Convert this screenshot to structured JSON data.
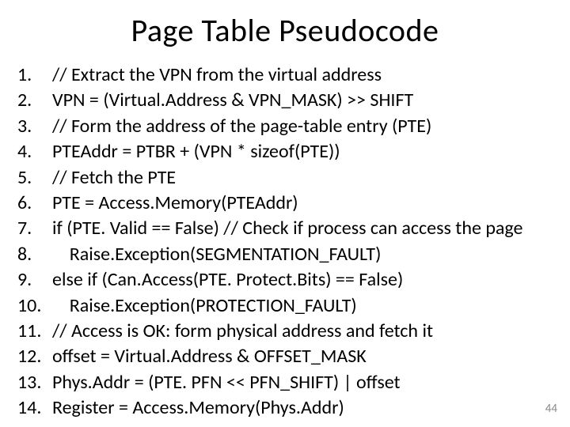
{
  "title": "Page Table Pseudocode",
  "lines": [
    {
      "n": "1.",
      "t": "// Extract the VPN from the virtual address"
    },
    {
      "n": "2.",
      "t": "VPN = (Virtual.Address & VPN_MASK) >> SHIFT"
    },
    {
      "n": "3.",
      "t": "// Form the address of the page-table entry (PTE)"
    },
    {
      "n": "4.",
      "t": "PTEAddr = PTBR + (VPN * sizeof(PTE))"
    },
    {
      "n": "5.",
      "t": "// Fetch the PTE"
    },
    {
      "n": "6.",
      "t": "PTE = Access.Memory(PTEAddr)"
    },
    {
      "n": "7.",
      "t": "if (PTE. Valid == False) // Check if process can access the page"
    },
    {
      "n": "8.",
      "t": "    Raise.Exception(SEGMENTATION_FAULT)"
    },
    {
      "n": "9.",
      "t": "else if (Can.Access(PTE. Protect.Bits) == False)"
    },
    {
      "n": "10.",
      "t": "    Raise.Exception(PROTECTION_FAULT)"
    },
    {
      "n": "11.",
      "t": "// Access is OK: form physical address and fetch it"
    },
    {
      "n": "12.",
      "t": "offset = Virtual.Address & OFFSET_MASK"
    },
    {
      "n": "13.",
      "t": "Phys.Addr = (PTE. PFN << PFN_SHIFT) | offset"
    },
    {
      "n": "14.",
      "t": "Register = Access.Memory(Phys.Addr)"
    }
  ],
  "page_number": "44"
}
